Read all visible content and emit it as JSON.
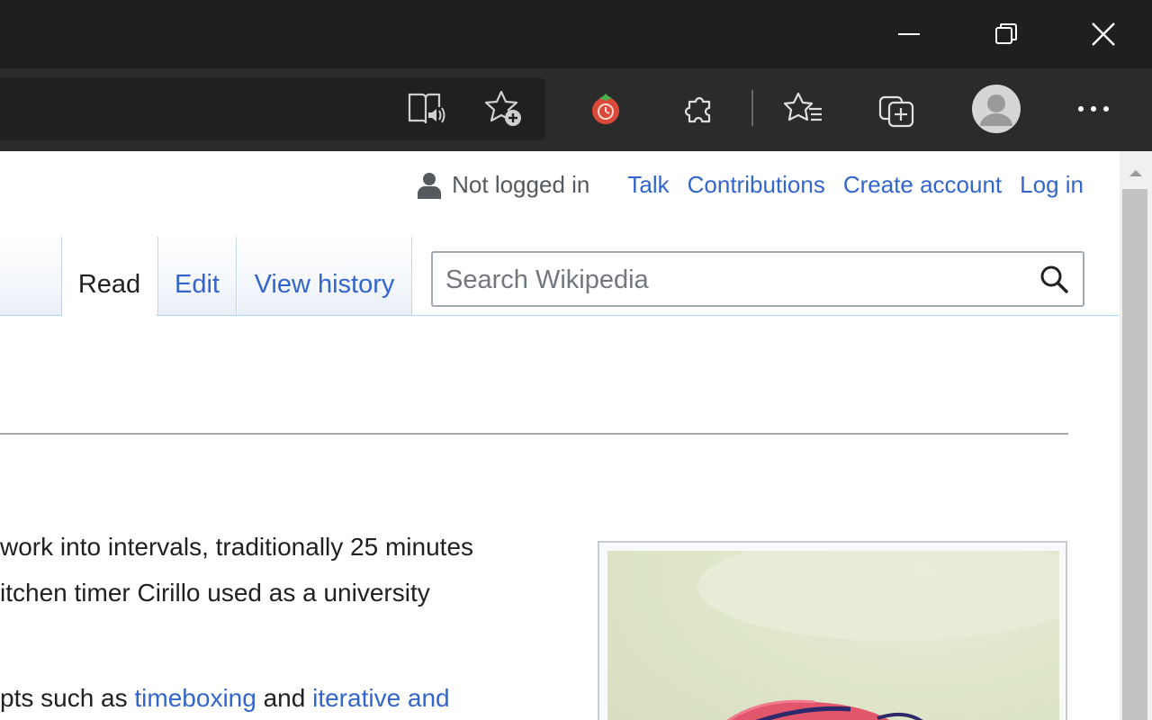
{
  "browser": {
    "window_controls": {
      "minimize": "minimize-icon",
      "restore": "restore-icon",
      "close": "close-icon"
    },
    "toolbar_icons": [
      "immersive-reader-icon",
      "add-favorite-icon",
      "tomato-timer-extension-icon",
      "extensions-icon",
      "favorites-icon",
      "collections-icon",
      "profile-avatar-icon",
      "more-icon"
    ]
  },
  "personal": {
    "status": "Not logged in",
    "links": [
      "Talk",
      "Contributions",
      "Create account",
      "Log in"
    ]
  },
  "tabs": {
    "read": "Read",
    "edit": "Edit",
    "history": "View history"
  },
  "search": {
    "placeholder": "Search Wikipedia"
  },
  "article": {
    "line1": "work into intervals, traditionally 25 minutes",
    "line2": "itchen timer Cirillo used as a university",
    "line3_pre": "pts such as ",
    "line3_link1": "timeboxing",
    "line3_mid": " and ",
    "line3_link2": "iterative and"
  },
  "colors": {
    "link": "#3366cc",
    "text": "#202122",
    "chrome_dark": "#1f1f1f",
    "toolbar": "#2b2b2b"
  }
}
